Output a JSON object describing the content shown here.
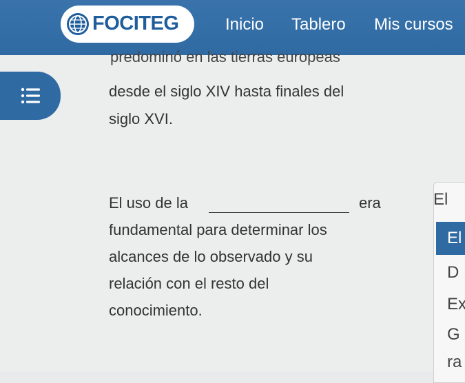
{
  "header": {
    "brand": "FOCITEG",
    "nav": [
      "Inicio",
      "Tablero",
      "Mis cursos"
    ]
  },
  "content": {
    "partial_line": "predominó en las tierras europeas",
    "paragraph1": [
      "desde el siglo XIV hasta finales del",
      "siglo XVI."
    ],
    "sentence_start": "El uso de la",
    "sentence_after_blank": "era",
    "paragraph2": [
      "fundamental para determinar los",
      "alcances de lo observado y su",
      "relación con el resto del",
      "conocimiento."
    ]
  },
  "dropdown": {
    "selected": "El",
    "options": [
      "El",
      "D",
      "Ex",
      "G",
      "ra"
    ]
  },
  "icons": {
    "menu": "menu-list-icon",
    "logo": "globe-icon"
  },
  "colors": {
    "accent": "#2f6aa3",
    "background": "#eceded"
  }
}
